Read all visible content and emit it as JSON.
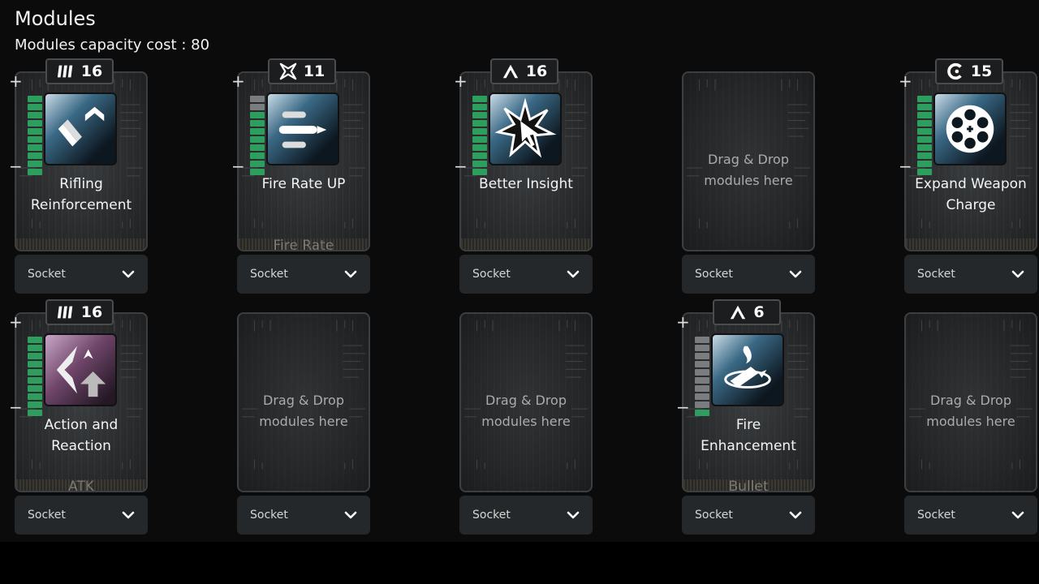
{
  "header": {
    "title": "Modules",
    "capacity_label": "Modules capacity cost : 80"
  },
  "colors": {
    "level_on": "#2e9e5f",
    "level_off": "#7a7d80",
    "background": "#0b0b0b"
  },
  "slots": [
    {
      "id": "s0",
      "filled": true,
      "cost": "16",
      "cost_icon": "triple-slash-icon",
      "name_line1": "Rifling",
      "name_line2": "Reinforcement",
      "type": "",
      "level": 10,
      "max_level": 10,
      "icon": "bullet-upgrade-icon",
      "theme": "blue",
      "socket": "Socket"
    },
    {
      "id": "s1",
      "filled": true,
      "cost": "11",
      "cost_icon": "cross-star-icon",
      "name_line1": "Fire Rate UP",
      "name_line2": "",
      "type": "Fire Rate",
      "level": 8,
      "max_level": 10,
      "icon": "three-bullets-icon",
      "theme": "blue",
      "socket": "Socket"
    },
    {
      "id": "s2",
      "filled": true,
      "cost": "16",
      "cost_icon": "caret-icon",
      "name_line1": "Better Insight",
      "name_line2": "",
      "type": "",
      "level": 10,
      "max_level": 10,
      "icon": "burst-cursor-icon",
      "theme": "blue",
      "socket": "Socket"
    },
    {
      "id": "s3",
      "filled": false,
      "drop_line1": "Drag & Drop",
      "drop_line2": "modules here",
      "socket": "Socket"
    },
    {
      "id": "s4",
      "filled": true,
      "cost": "15",
      "cost_icon": "c-shape-icon",
      "name_line1": "Expand Weapon",
      "name_line2": "Charge",
      "type": "",
      "level": 10,
      "max_level": 10,
      "icon": "revolver-cylinder-icon",
      "theme": "blue",
      "socket": "Socket"
    },
    {
      "id": "s5",
      "filled": true,
      "cost": "16",
      "cost_icon": "triple-slash-icon",
      "name_line1": "Action and",
      "name_line2": "Reaction",
      "type": "ATK",
      "level": 10,
      "max_level": 10,
      "icon": "arrows-up-icon",
      "theme": "purple",
      "socket": "Socket"
    },
    {
      "id": "s6",
      "filled": false,
      "drop_line1": "Drag & Drop",
      "drop_line2": "modules here",
      "socket": "Socket"
    },
    {
      "id": "s7",
      "filled": false,
      "drop_line1": "Drag & Drop",
      "drop_line2": "modules here",
      "socket": "Socket"
    },
    {
      "id": "s8",
      "filled": true,
      "cost": "6",
      "cost_icon": "caret-icon",
      "name_line1": "Fire",
      "name_line2": "Enhancement",
      "type": "Bullet",
      "level": 1,
      "max_level": 10,
      "icon": "bullet-flame-icon",
      "theme": "blue",
      "socket": "Socket"
    },
    {
      "id": "s9",
      "filled": false,
      "drop_line1": "Drag & Drop",
      "drop_line2": "modules here",
      "socket": "Socket"
    }
  ]
}
